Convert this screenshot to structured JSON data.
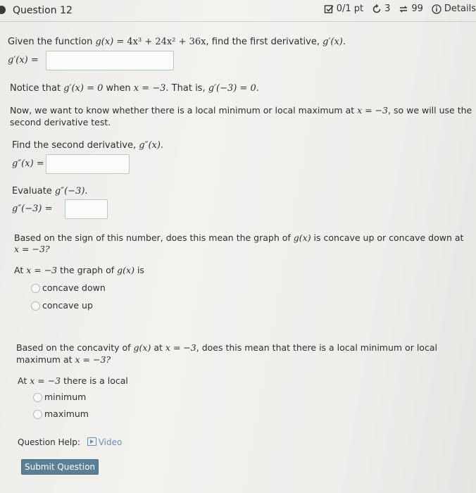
{
  "header": {
    "question_title": "Question 12",
    "score": "0/1 pt",
    "retries": "3",
    "attempts": "99",
    "details_label": "Details"
  },
  "part1": {
    "prompt_prefix": "Given the function ",
    "function_lhs": "g(x)",
    "function_rhs": " = 4x³ + 24x² + 36x",
    "prompt_suffix": ", find the first derivative, ",
    "target": "g′(x)",
    "answer_label": "g′(x) =",
    "answer_value": ""
  },
  "notice": {
    "text_a": "Notice that ",
    "expr_a": "g′(x) = 0",
    "text_b": " when ",
    "expr_b": "x = −3",
    "text_c": ". That is, ",
    "expr_c": "g′(−3) = 0",
    "text_d": "."
  },
  "now": {
    "line1_a": "Now, we want to know whether there is a local minimum or local maximum at ",
    "line1_expr": "x = −3",
    "line1_b": ", so we will use the",
    "line2": "second derivative test."
  },
  "part2": {
    "prompt": "Find the second derivative, ",
    "target": "g″(x)",
    "answer_label": "g″(x) =",
    "answer_value": ""
  },
  "part3": {
    "prompt": "Evaluate ",
    "target": "g″(−3)",
    "answer_label": "g″(−3) =",
    "answer_value": ""
  },
  "part4": {
    "q_line1_a": "Based on the sign of this number, does this mean the graph of ",
    "q_line1_expr": "g(x)",
    "q_line1_b": " is concave up or concave down at",
    "q_line2": "x = −3?",
    "stem_a": "At ",
    "stem_expr": "x = −3",
    "stem_b": " the graph of ",
    "stem_expr2": "g(x)",
    "stem_c": " is",
    "options": [
      "concave down",
      "concave up"
    ]
  },
  "part5": {
    "q_line1_a": "Based on the concavity of ",
    "q_line1_expr": "g(x)",
    "q_line1_b": " at ",
    "q_line1_expr2": "x = −3",
    "q_line1_c": ", does this mean that there is a local minimum or local",
    "q_line2_a": "maximum at ",
    "q_line2_expr": "x = −3?",
    "stem_a": "At ",
    "stem_expr": "x = −3",
    "stem_b": " there is a local",
    "options": [
      "minimum",
      "maximum"
    ]
  },
  "help": {
    "label": "Question Help:",
    "video_label": "Video"
  },
  "submit_label": "Submit Question"
}
